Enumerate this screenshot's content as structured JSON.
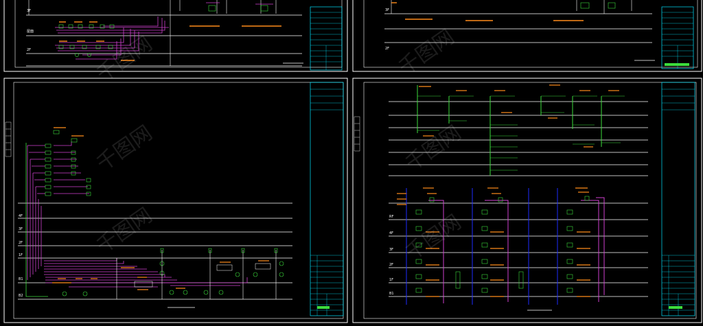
{
  "colors": {
    "background": "#000000",
    "sheet_border": "#ffffff",
    "title_block": "#00e5ff",
    "bus": "#ffffff",
    "feeder": "#d040d0",
    "device": "#3cdc3c",
    "label": "#ff8c1a",
    "riser": "#1e2cff"
  },
  "sheets": [
    {
      "id": "top-left",
      "floor_labels": [
        "3F",
        "屋面",
        "2F"
      ]
    },
    {
      "id": "top-right",
      "floor_labels": [
        "3F",
        "2F"
      ]
    },
    {
      "id": "bottom-left",
      "floor_labels": [
        "4F",
        "3F",
        "2F",
        "1F",
        "B1",
        "B2"
      ]
    },
    {
      "id": "bottom-right",
      "floor_labels": [
        "RF",
        "4F",
        "3F",
        "2F",
        "1F",
        "B1"
      ]
    }
  ],
  "watermark": {
    "text": "千图网"
  }
}
